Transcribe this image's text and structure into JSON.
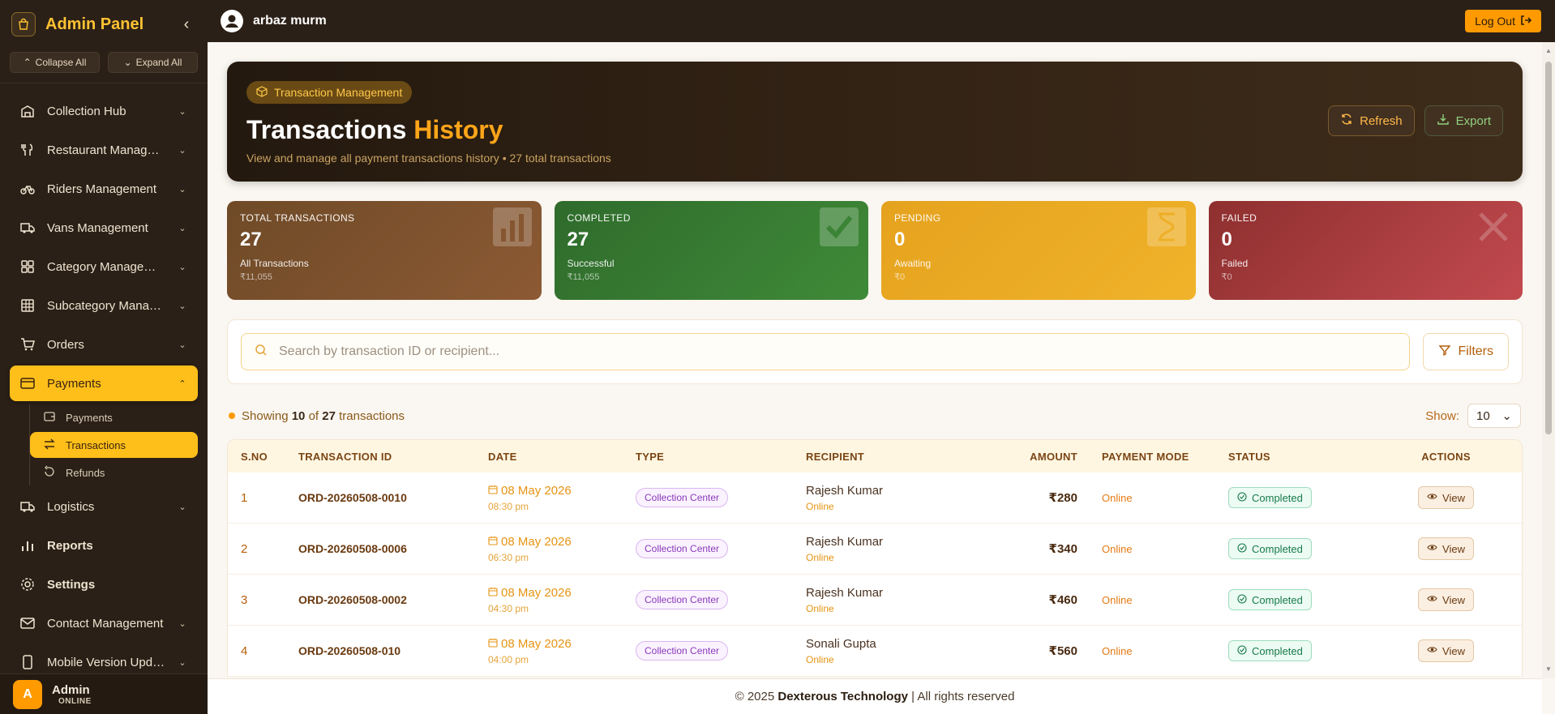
{
  "sidebar": {
    "title": "Admin Panel",
    "collapse_all": "Collapse All",
    "expand_all": "Expand All",
    "items": [
      {
        "label": "Collection Hub",
        "icon": "building-icon",
        "chevron": true
      },
      {
        "label": "Restaurant Management",
        "icon": "utensils-icon",
        "chevron": true
      },
      {
        "label": "Riders Management",
        "icon": "bicycle-icon",
        "chevron": true
      },
      {
        "label": "Vans Management",
        "icon": "truck-icon",
        "chevron": true
      },
      {
        "label": "Category Management",
        "icon": "grid-icon",
        "chevron": true
      },
      {
        "label": "Subcategory Management",
        "icon": "table-icon",
        "chevron": true
      },
      {
        "label": "Orders",
        "icon": "cart-icon",
        "chevron": true
      },
      {
        "label": "Payments",
        "icon": "card-icon",
        "chevron": true,
        "active": true
      }
    ],
    "sub_items": [
      {
        "label": "Payments",
        "icon": "wallet-icon"
      },
      {
        "label": "Transactions",
        "icon": "arrows-icon",
        "active": true
      },
      {
        "label": "Refunds",
        "icon": "refund-icon"
      }
    ],
    "items_after": [
      {
        "label": "Logistics",
        "icon": "truck-icon",
        "chevron": true
      },
      {
        "label": "Reports",
        "icon": "bar-chart-icon",
        "chevron": false,
        "bold": true
      },
      {
        "label": "Settings",
        "icon": "gear-icon",
        "chevron": false,
        "bold": true
      },
      {
        "label": "Contact Management",
        "icon": "mail-icon",
        "chevron": true
      },
      {
        "label": "Mobile Version Update",
        "icon": "phone-icon",
        "chevron": true
      }
    ],
    "footer": {
      "avatar_letter": "A",
      "name": "Admin",
      "status": "ONLINE"
    }
  },
  "topbar": {
    "username": "arbaz murm",
    "logout_label": "Log Out"
  },
  "hero": {
    "pill": "Transaction Management",
    "title_main": "Transactions",
    "title_accent": "History",
    "subtitle": "View and manage all payment transactions history • 27 total transactions",
    "refresh_label": "Refresh",
    "export_label": "Export"
  },
  "stats": [
    {
      "caption": "TOTAL TRANSACTIONS",
      "value": "27",
      "line1": "All Transactions",
      "line2": "₹11,055"
    },
    {
      "caption": "COMPLETED",
      "value": "27",
      "line1": "Successful",
      "line2": "₹11,055"
    },
    {
      "caption": "PENDING",
      "value": "0",
      "line1": "Awaiting",
      "line2": "₹0"
    },
    {
      "caption": "FAILED",
      "value": "0",
      "line1": "Failed",
      "line2": "₹0"
    }
  ],
  "search": {
    "placeholder": "Search by transaction ID or recipient...",
    "filters_label": "Filters"
  },
  "listing": {
    "showing_prefix": "Showing",
    "shown": "10",
    "of": "of",
    "total": "27",
    "suffix": "transactions",
    "show_label": "Show:",
    "show_value": "10"
  },
  "table": {
    "headers": [
      "S.NO",
      "TRANSACTION ID",
      "DATE",
      "TYPE",
      "RECIPIENT",
      "AMOUNT",
      "PAYMENT MODE",
      "STATUS",
      "ACTIONS"
    ],
    "rows": [
      {
        "sno": "1",
        "tid": "ORD-20260508-0010",
        "date": "08 May 2026",
        "time": "08:30 pm",
        "type": "Collection Center",
        "recipient": "Rajesh Kumar",
        "recipient_sub": "Online",
        "amount": "₹280",
        "mode": "Online",
        "status": "Completed",
        "action": "View"
      },
      {
        "sno": "2",
        "tid": "ORD-20260508-0006",
        "date": "08 May 2026",
        "time": "06:30 pm",
        "type": "Collection Center",
        "recipient": "Rajesh Kumar",
        "recipient_sub": "Online",
        "amount": "₹340",
        "mode": "Online",
        "status": "Completed",
        "action": "View"
      },
      {
        "sno": "3",
        "tid": "ORD-20260508-0002",
        "date": "08 May 2026",
        "time": "04:30 pm",
        "type": "Collection Center",
        "recipient": "Rajesh Kumar",
        "recipient_sub": "Online",
        "amount": "₹460",
        "mode": "Online",
        "status": "Completed",
        "action": "View"
      },
      {
        "sno": "4",
        "tid": "ORD-20260508-010",
        "date": "08 May 2026",
        "time": "04:00 pm",
        "type": "Collection Center",
        "recipient": "Sonali Gupta",
        "recipient_sub": "Online",
        "amount": "₹560",
        "mode": "Online",
        "status": "Completed",
        "action": "View"
      }
    ]
  },
  "footer": {
    "prefix": "© 2025",
    "company": "Dexterous Technology",
    "suffix": "| All rights reserved"
  },
  "colors": {
    "accent": "#ffbf1a",
    "sidebar_bg": "#2b2017",
    "completed": "#3f8a38",
    "pending": "#f0b32a",
    "failed": "#c24a4f"
  }
}
